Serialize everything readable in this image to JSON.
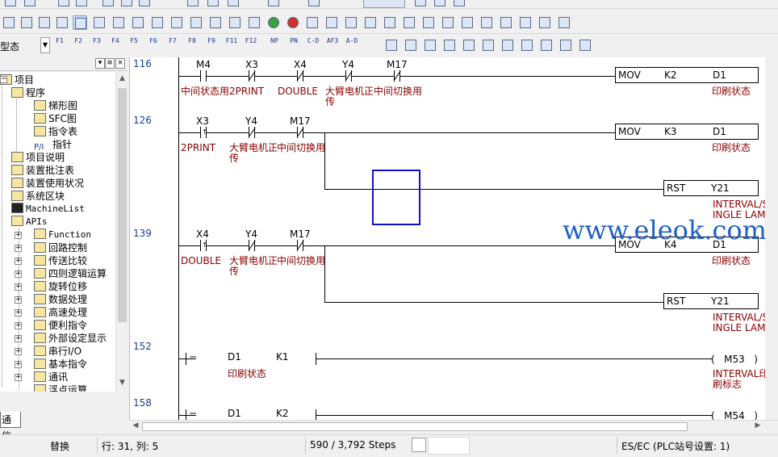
{
  "toolbar": {
    "mode_label": "型态",
    "function_keys": [
      "F1",
      "F2",
      "F3",
      "F4",
      "F5",
      "F6",
      "F7",
      "F8",
      "F9",
      "F11",
      "F12",
      "NP",
      "PN",
      "C-D",
      "AF3",
      "A-D"
    ]
  },
  "tree": {
    "items": [
      {
        "label": "项目",
        "icon": "project-icon"
      },
      {
        "label": "程序",
        "icon": "program-folder-icon"
      },
      {
        "label": "梯形图",
        "icon": "ladder-icon"
      },
      {
        "label": "SFC图",
        "icon": "sfc-icon"
      },
      {
        "label": "指令表",
        "icon": "instruction-list-icon"
      },
      {
        "label": "指针",
        "icon": "pointer-icon"
      },
      {
        "label": "项目说明",
        "icon": "description-icon"
      },
      {
        "label": "装置批注表",
        "icon": "device-comment-icon"
      },
      {
        "label": "装置使用状况",
        "icon": "device-usage-icon"
      },
      {
        "label": "系统区块",
        "icon": "system-block-icon"
      },
      {
        "label": "MachineList",
        "icon": "machine-list-icon"
      },
      {
        "label": "APIs",
        "icon": "api-icon"
      },
      {
        "label": "Function",
        "icon": "folder-icon"
      },
      {
        "label": "回路控制",
        "icon": "folder-icon"
      },
      {
        "label": "传送比较",
        "icon": "folder-icon"
      },
      {
        "label": "四则逻辑运算",
        "icon": "folder-icon"
      },
      {
        "label": "旋转位移",
        "icon": "folder-icon"
      },
      {
        "label": "数据处理",
        "icon": "folder-icon"
      },
      {
        "label": "高速处理",
        "icon": "folder-icon"
      },
      {
        "label": "便利指令",
        "icon": "folder-icon"
      },
      {
        "label": "外部设定显示",
        "icon": "folder-icon"
      },
      {
        "label": "串行I/O",
        "icon": "folder-icon"
      },
      {
        "label": "基本指令",
        "icon": "folder-icon"
      },
      {
        "label": "通讯",
        "icon": "folder-icon"
      },
      {
        "label": "浮点运算",
        "icon": "folder-icon"
      }
    ],
    "tab_label": "通信"
  },
  "ladder": {
    "steps": [
      "116",
      "126",
      "139",
      "152",
      "158"
    ],
    "r116": {
      "contacts": [
        "M4",
        "X3",
        "X4",
        "Y4",
        "M17"
      ],
      "comments": [
        "中间状态用",
        "2PRINT",
        "DOUBLE",
        "大臂电机正",
        "中间切换用"
      ],
      "comment_wrap": "传",
      "instr": {
        "op": "MOV",
        "src": "K2",
        "dst": "D1",
        "comment": "印刷状态"
      }
    },
    "r126": {
      "contacts": [
        "X3",
        "Y4",
        "M17"
      ],
      "comments": [
        "2PRINT",
        "大臂电机正",
        "中间切换用"
      ],
      "comment_wrap": "传",
      "instr": {
        "op": "MOV",
        "src": "K3",
        "dst": "D1",
        "comment": "印刷状态"
      },
      "rst": {
        "op": "RST",
        "dev": "Y21",
        "comment1": "INTERVAL/S",
        "comment2": "INGLE LAMP"
      }
    },
    "r139": {
      "contacts": [
        "X4",
        "Y4",
        "M17"
      ],
      "comments": [
        "DOUBLE",
        "大臂电机正",
        "中间切换用"
      ],
      "comment_wrap": "传",
      "instr": {
        "op": "MOV",
        "src": "K4",
        "dst": "D1",
        "comment": "印刷状态"
      },
      "rst": {
        "op": "RST",
        "dev": "Y21",
        "comment1": "INTERVAL/S",
        "comment2": "INGLE LAMP"
      }
    },
    "r152": {
      "cmp": "=",
      "a": "D1",
      "b": "K1",
      "a_comment": "印刷状态",
      "coil": "M53",
      "coil_comment1": "INTERVAL印",
      "coil_comment2": "刷标志"
    },
    "r158": {
      "cmp": "=",
      "a": "D1",
      "b": "K2",
      "coil": "M54"
    }
  },
  "watermark": "www.eleok.com",
  "status": {
    "mode": "替换",
    "position": "行: 31, 列: 5",
    "steps": "590 / 3,792 Steps",
    "plc": "ES/EC (PLC站号设置: 1)"
  }
}
